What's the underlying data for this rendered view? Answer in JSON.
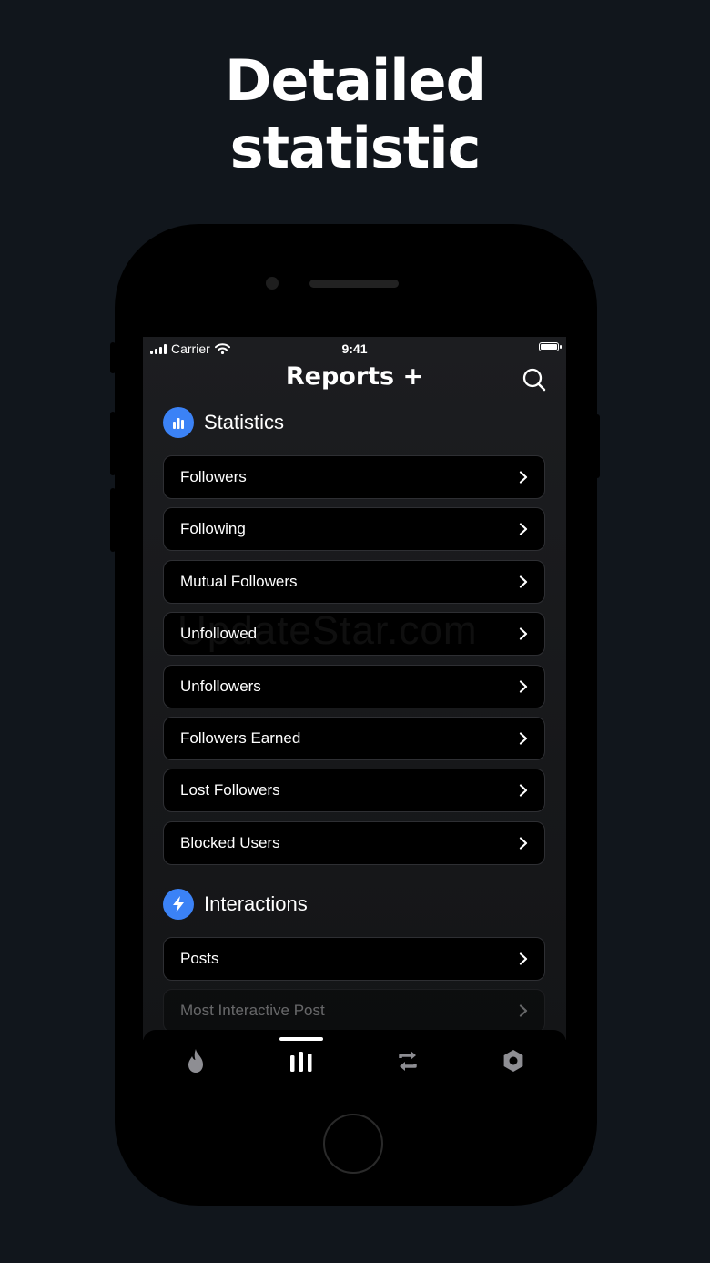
{
  "headline": {
    "line1": "Detailed",
    "line2": "statistic"
  },
  "status_bar": {
    "carrier": "Carrier",
    "time": "9:41"
  },
  "nav": {
    "title": "Reports +"
  },
  "sections": {
    "statistics": {
      "title": "Statistics",
      "items": [
        "Followers",
        "Following",
        "Mutual Followers",
        "Unfollowed",
        "Unfollowers",
        "Followers Earned",
        "Lost Followers",
        "Blocked Users"
      ]
    },
    "interactions": {
      "title": "Interactions",
      "items": [
        "Posts",
        "Most Interactive Post"
      ]
    }
  },
  "watermark": "UpdateStar.com",
  "colors": {
    "background": "#11161c",
    "accent": "#3b82f6",
    "card": "#000000"
  },
  "tabs": [
    {
      "name": "flame-icon",
      "active": false
    },
    {
      "name": "bar-chart-icon",
      "active": true
    },
    {
      "name": "repost-icon",
      "active": false
    },
    {
      "name": "settings-icon",
      "active": false
    }
  ]
}
